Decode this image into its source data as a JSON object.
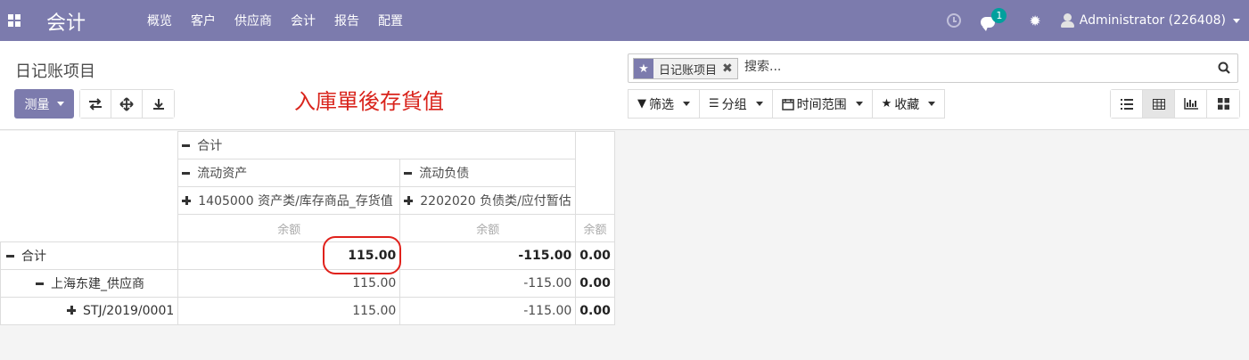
{
  "navbar": {
    "brand": "会计",
    "menu": [
      "概览",
      "客户",
      "供应商",
      "会计",
      "报告",
      "配置"
    ],
    "chat_count": "1",
    "user": "Administrator (226408)"
  },
  "control": {
    "breadcrumb": "日记账项目",
    "measure_label": "测量",
    "annotation": "入庫單後存貨值",
    "search": {
      "facet_label": "日记账项目",
      "placeholder": "搜索..."
    },
    "filters": {
      "filter": "筛选",
      "group": "分组",
      "time_range": "时间范围",
      "favorites": "收藏"
    }
  },
  "pivot": {
    "col_total": "合计",
    "col_groups": [
      "流动资产",
      "流动负债"
    ],
    "col_accounts": [
      "1405000 资产类/库存商品_存货值",
      "2202020 负债类/应付暂估"
    ],
    "measure": "余额",
    "rows": [
      {
        "label": "合计",
        "values": [
          "115.00",
          "-115.00",
          "0.00"
        ]
      },
      {
        "label": "上海东建_供应商",
        "values": [
          "115.00",
          "-115.00",
          "0.00"
        ]
      },
      {
        "label": "STJ/2019/0001",
        "values": [
          "115.00",
          "-115.00",
          "0.00"
        ]
      }
    ]
  },
  "colors": {
    "brand": "#7c7bad",
    "badge": "#00a09d",
    "annotation": "#d9241c"
  }
}
